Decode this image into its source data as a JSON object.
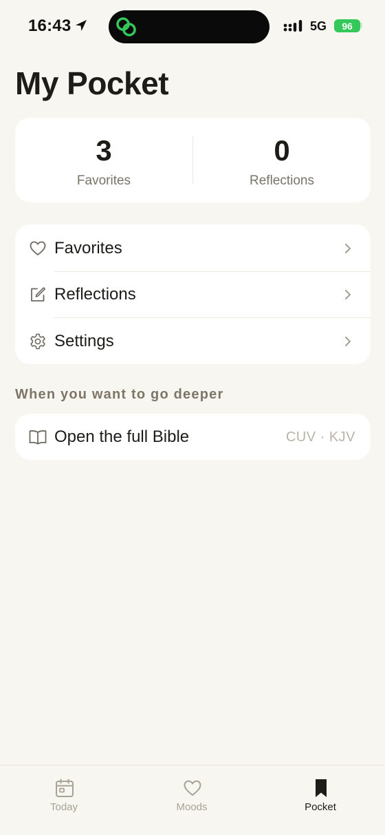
{
  "status_bar": {
    "time": "16:43",
    "network": "5G",
    "battery": "96",
    "battery_color": "#34c759",
    "island_icon_color": "#34c759",
    "icons": [
      "location-arrow-icon",
      "linked-rings-icon",
      "signal-icon",
      "battery-icon"
    ]
  },
  "page_title": "My Pocket",
  "stats": [
    {
      "value": "3",
      "label": "Favorites"
    },
    {
      "value": "0",
      "label": "Reflections"
    }
  ],
  "menu": [
    {
      "label": "Favorites",
      "icon": "heart-icon"
    },
    {
      "label": "Reflections",
      "icon": "edit-icon"
    },
    {
      "label": "Settings",
      "icon": "gear-icon"
    }
  ],
  "section_label": "When you want to go deeper",
  "bible": {
    "label": "Open the full Bible",
    "versions": "CUV · KJV",
    "icon": "open-book-icon"
  },
  "tabs": [
    {
      "label": "Today",
      "icon": "calendar-icon",
      "active": false
    },
    {
      "label": "Moods",
      "icon": "heart-icon",
      "active": false
    },
    {
      "label": "Pocket",
      "icon": "bookmark-icon",
      "active": true
    }
  ],
  "colors": {
    "background": "#f8f6f1",
    "card": "#ffffff",
    "text": "#1e1c19",
    "muted": "#7a7468",
    "tab_inactive": "#a8a195"
  }
}
